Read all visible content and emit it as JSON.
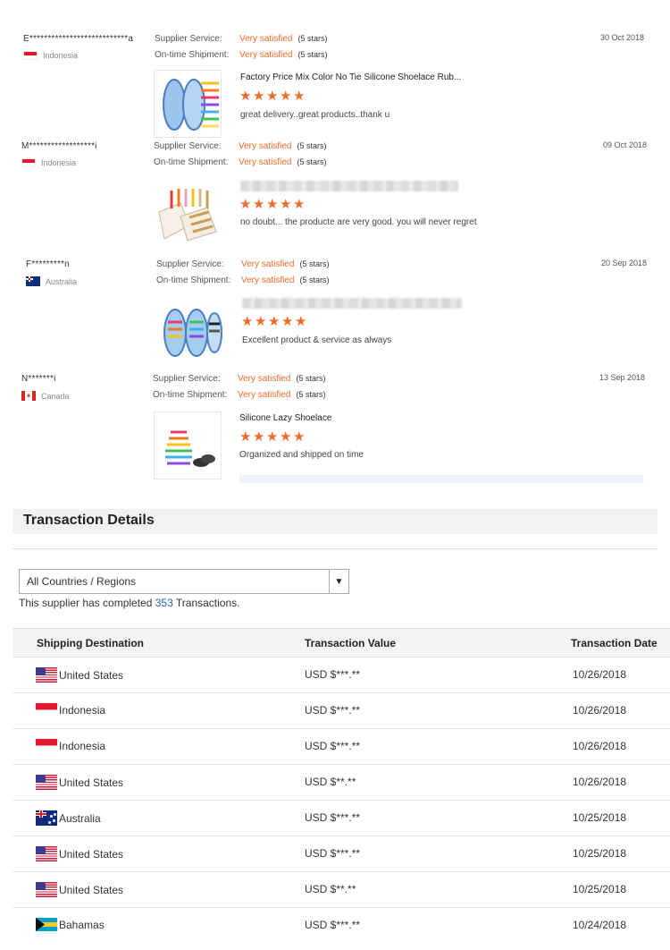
{
  "reviews": [
    {
      "reviewer": "E***************************a",
      "country": "Indonesia",
      "flag": "indonesia-flag",
      "supplier_label": "Supplier Service:",
      "supplier_value": "Very satisfied",
      "supplier_stars": "(5 stars)",
      "shipment_label": "On-time Shipment:",
      "shipment_value": "Very satisfied",
      "shipment_stars": "(5 stars)",
      "date": "30 Oct 2018",
      "product_title": "Factory Price Mix Color No Tie Silicone Shoelace Rub...",
      "rating": 5,
      "comment": "great delivery..great products..thank u"
    },
    {
      "reviewer": "M******************i",
      "country": "Indonesia",
      "flag": "indonesia-flag",
      "supplier_label": "Supplier Service:",
      "supplier_value": "Very satisfied",
      "supplier_stars": "(5 stars)",
      "shipment_label": "On-time Shipment:",
      "shipment_value": "Very satisfied",
      "shipment_stars": "(5 stars)",
      "date": "09 Oct 2018",
      "product_title": "",
      "rating": 5,
      "comment": "no doubt... the producte are very good. you will never regret"
    },
    {
      "reviewer": "F*********n",
      "country": "Australia",
      "flag": "australia-flag",
      "supplier_label": "Supplier Service:",
      "supplier_value": "Very satisfied",
      "supplier_stars": "(5 stars)",
      "shipment_label": "On-time Shipment:",
      "shipment_value": "Very satisfied",
      "shipment_stars": "(5 stars)",
      "date": "20 Sep 2018",
      "product_title": "",
      "rating": 5,
      "comment": "Excellent product & service as always"
    },
    {
      "reviewer": "N*******i",
      "country": "Canada",
      "flag": "canada-flag",
      "supplier_label": "Supplier Service:",
      "supplier_value": "Very satisfied",
      "supplier_stars": "(5 stars)",
      "shipment_label": "On-time Shipment:",
      "shipment_value": "Very satisfied",
      "shipment_stars": "(5 stars)",
      "date": "13 Sep 2018",
      "product_title": "Silicone Lazy Shoelace",
      "rating": 5,
      "comment": "Organized and shipped on time"
    }
  ],
  "transactions": {
    "title": "Transaction Details",
    "filter": {
      "selected": "All Countries / Regions",
      "arrow_icon": "triangle-down-icon"
    },
    "summary_prefix": "This supplier has completed ",
    "summary_count": "353",
    "summary_suffix": " Transactions.",
    "columns": [
      "Shipping Destination",
      "Transaction Value",
      "Transaction Date"
    ],
    "rows": [
      {
        "flag": "us-flag",
        "destination": "United States",
        "value": "USD $***.**",
        "date": "10/26/2018"
      },
      {
        "flag": "indonesia-flag",
        "destination": "Indonesia",
        "value": "USD $***.**",
        "date": "10/26/2018"
      },
      {
        "flag": "indonesia-flag",
        "destination": "Indonesia",
        "value": "USD $***.**",
        "date": "10/26/2018"
      },
      {
        "flag": "us-flag",
        "destination": "United States",
        "value": "USD $**.**",
        "date": "10/26/2018"
      },
      {
        "flag": "australia-flag",
        "destination": "Australia",
        "value": "USD $***.**",
        "date": "10/25/2018"
      },
      {
        "flag": "us-flag",
        "destination": "United States",
        "value": "USD $***.**",
        "date": "10/25/2018"
      },
      {
        "flag": "us-flag",
        "destination": "United States",
        "value": "USD $**.**",
        "date": "10/25/2018"
      },
      {
        "flag": "bahamas-flag",
        "destination": "Bahamas",
        "value": "USD $***.**",
        "date": "10/24/2018"
      }
    ]
  },
  "colors": {
    "accent_orange": "#f26b2a",
    "link_blue": "#1a66c9",
    "header_bg": "#f2f2f2"
  }
}
